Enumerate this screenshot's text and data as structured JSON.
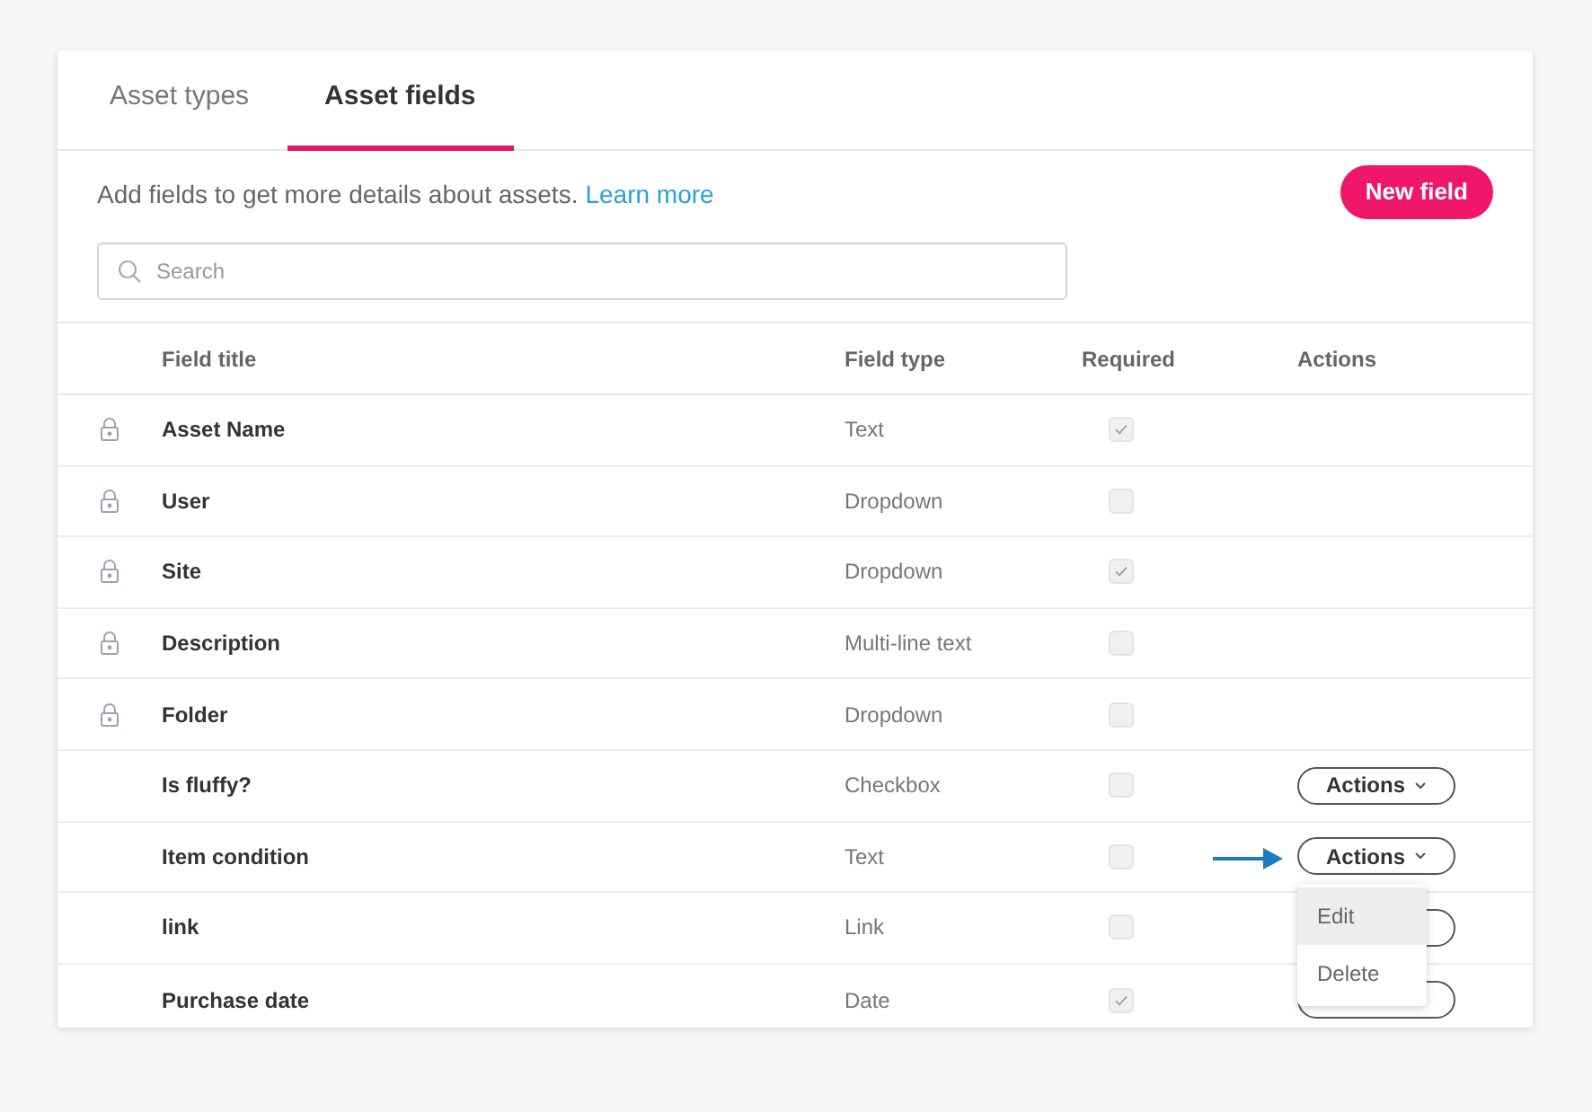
{
  "tabs": [
    {
      "label": "Asset types",
      "selected": false
    },
    {
      "label": "Asset fields",
      "selected": true
    }
  ],
  "intro": {
    "text": "Add fields to get more details about assets.",
    "link": "Learn more"
  },
  "new_button": "New field",
  "search": {
    "placeholder": "Search"
  },
  "table": {
    "columns": [
      "Field title",
      "Field type",
      "Required",
      "Actions"
    ],
    "rows": [
      {
        "kind": "locked",
        "title": "Asset Name",
        "type": "Text",
        "required": true
      },
      {
        "kind": "locked",
        "title": "User",
        "type": "Dropdown",
        "required": false
      },
      {
        "kind": "locked",
        "title": "Site",
        "type": "Dropdown",
        "required": true
      },
      {
        "kind": "locked",
        "title": "Description",
        "type": "Multi-line text",
        "required": false
      },
      {
        "kind": "locked",
        "title": "Folder",
        "type": "Dropdown",
        "required": false
      },
      {
        "kind": "custom",
        "title": "Is fluffy?",
        "type": "Checkbox",
        "required": false,
        "action": "Actions"
      },
      {
        "kind": "custom",
        "title": "Item condition",
        "type": "Text",
        "required": false,
        "action": "Actions",
        "menu": {
          "items": [
            {
              "label": "Edit",
              "selected": true
            },
            {
              "label": "Delete",
              "selected": false
            }
          ]
        }
      },
      {
        "kind": "custom",
        "title": "link",
        "type": "Link",
        "required": false,
        "action_covered": true
      },
      {
        "kind": "custom",
        "title": "Purchase date",
        "type": "Date",
        "required": true,
        "action_covered": true
      }
    ]
  }
}
